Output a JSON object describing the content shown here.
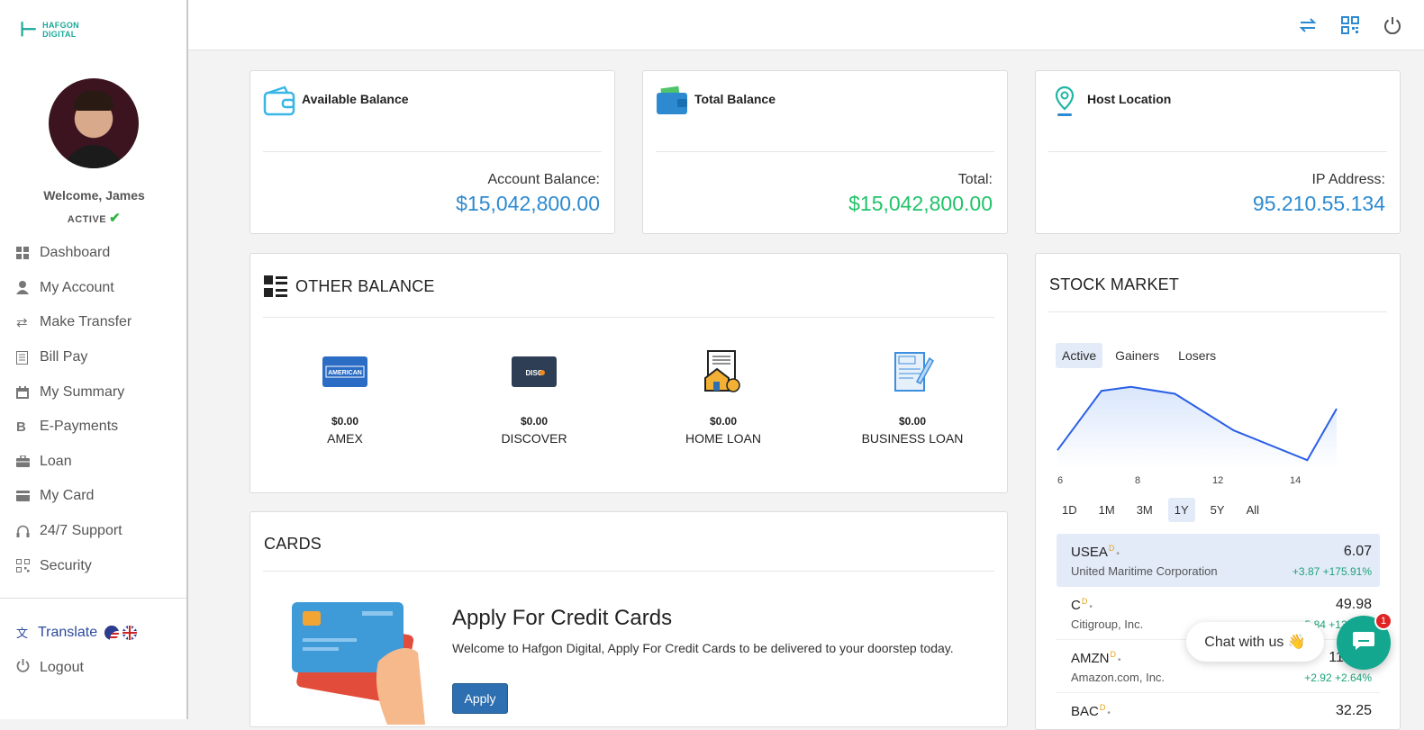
{
  "brand": {
    "line1": "HAFGON",
    "line2": "DIGITAL"
  },
  "user": {
    "welcome": "Welcome, James",
    "status": "ACTIVE"
  },
  "sidebar": {
    "items": [
      {
        "label": "Dashboard",
        "icon": "grid-icon"
      },
      {
        "label": "My Account",
        "icon": "user-icon"
      },
      {
        "label": "Make Transfer",
        "icon": "transfer-icon"
      },
      {
        "label": "Bill Pay",
        "icon": "bill-icon"
      },
      {
        "label": "My Summary",
        "icon": "calendar-icon"
      },
      {
        "label": "E-Payments",
        "icon": "bitcoin-icon"
      },
      {
        "label": "Loan",
        "icon": "briefcase-icon"
      },
      {
        "label": "My Card",
        "icon": "credit-card-icon"
      },
      {
        "label": "24/7 Support",
        "icon": "headset-icon"
      },
      {
        "label": "Security",
        "icon": "qr-icon"
      }
    ],
    "translate": "Translate",
    "logout": "Logout"
  },
  "balances": {
    "available": {
      "title": "Available Balance",
      "label": "Account Balance:",
      "value": "$15,042,800.00"
    },
    "total": {
      "title": "Total Balance",
      "label": "Total:",
      "value": "$15,042,800.00"
    },
    "host": {
      "title": "Host Location",
      "label": "IP Address:",
      "value": "95.210.55.134"
    }
  },
  "other_balance": {
    "title": "OTHER BALANCE",
    "items": [
      {
        "amount": "$0.00",
        "name": "AMEX",
        "icon": "amex-icon"
      },
      {
        "amount": "$0.00",
        "name": "DISCOVER",
        "icon": "discover-icon"
      },
      {
        "amount": "$0.00",
        "name": "HOME LOAN",
        "icon": "home-loan-icon"
      },
      {
        "amount": "$0.00",
        "name": "BUSINESS LOAN",
        "icon": "business-loan-icon"
      }
    ]
  },
  "cards": {
    "title": "CARDS",
    "heading": "Apply For Credit Cards",
    "description": "Welcome to Hafgon Digital, Apply For Credit Cards to be delivered to your doorstep today.",
    "button": "Apply"
  },
  "stock_market": {
    "title": "STOCK MARKET",
    "tabs": [
      "Active",
      "Gainers",
      "Losers"
    ],
    "active_tab": "Active",
    "ticks": [
      "6",
      "8",
      "12",
      "14"
    ],
    "ranges": [
      "1D",
      "1M",
      "3M",
      "1Y",
      "5Y",
      "All"
    ],
    "active_range": "1Y",
    "stocks": [
      {
        "symbol": "USEA",
        "name": "United Maritime Corporation",
        "price": "6.07",
        "change": "+3.87  +175.91%"
      },
      {
        "symbol": "C",
        "name": "Citigroup, Inc.",
        "price": "49.98",
        "change": "+5.84  +13.22%"
      },
      {
        "symbol": "AMZN",
        "name": "Amazon.com, Inc.",
        "price": "113.65",
        "change": "+2.92  +2.64%"
      },
      {
        "symbol": "BAC",
        "name": "",
        "price": "32.25",
        "change": ""
      }
    ]
  },
  "chart_data": {
    "type": "area",
    "x": [
      5.5,
      7,
      8,
      9.5,
      11.5,
      14,
      15
    ],
    "y": [
      0.18,
      0.78,
      0.82,
      0.75,
      0.38,
      0.08,
      0.6
    ],
    "xticks": [
      "6",
      "8",
      "12",
      "14"
    ],
    "title": "",
    "xlabel": "",
    "ylabel": ""
  },
  "chat": {
    "label": "Chat with us 👋",
    "badge": "1"
  },
  "colors": {
    "accent": "#2d8ad0",
    "green": "#21c36a",
    "teal": "#13a78f",
    "button": "#2d6fb0"
  }
}
